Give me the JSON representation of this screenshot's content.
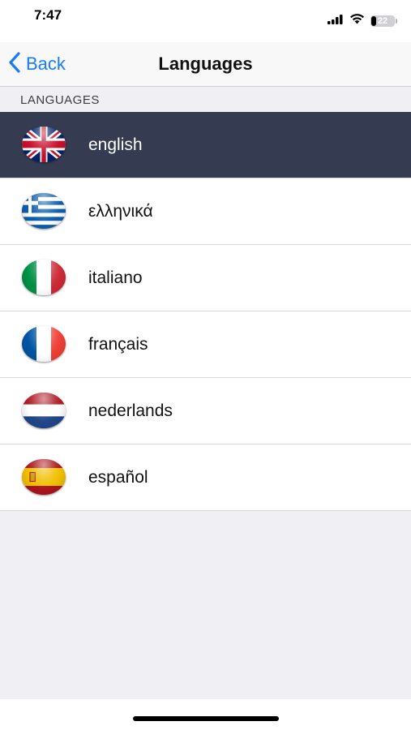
{
  "status_bar": {
    "time": "7:47",
    "battery_level": "22",
    "battery_fraction": 0.22,
    "icons": [
      "signal-icon",
      "wifi-icon",
      "battery-icon"
    ]
  },
  "nav": {
    "back_label": "Back",
    "title": "Languages"
  },
  "section": {
    "header": "LANGUAGES"
  },
  "languages": [
    {
      "name": "english",
      "flag": "uk-flag-icon",
      "selected": true
    },
    {
      "name": "ελληνικά",
      "flag": "greece-flag-icon",
      "selected": false
    },
    {
      "name": "italiano",
      "flag": "italy-flag-icon",
      "selected": false
    },
    {
      "name": "français",
      "flag": "france-flag-icon",
      "selected": false
    },
    {
      "name": "nederlands",
      "flag": "netherlands-flag-icon",
      "selected": false
    },
    {
      "name": "español",
      "flag": "spain-flag-icon",
      "selected": false
    }
  ],
  "colors": {
    "accent": "#1a7cf5",
    "selected_row": "#353b51",
    "background": "#efeff4"
  }
}
